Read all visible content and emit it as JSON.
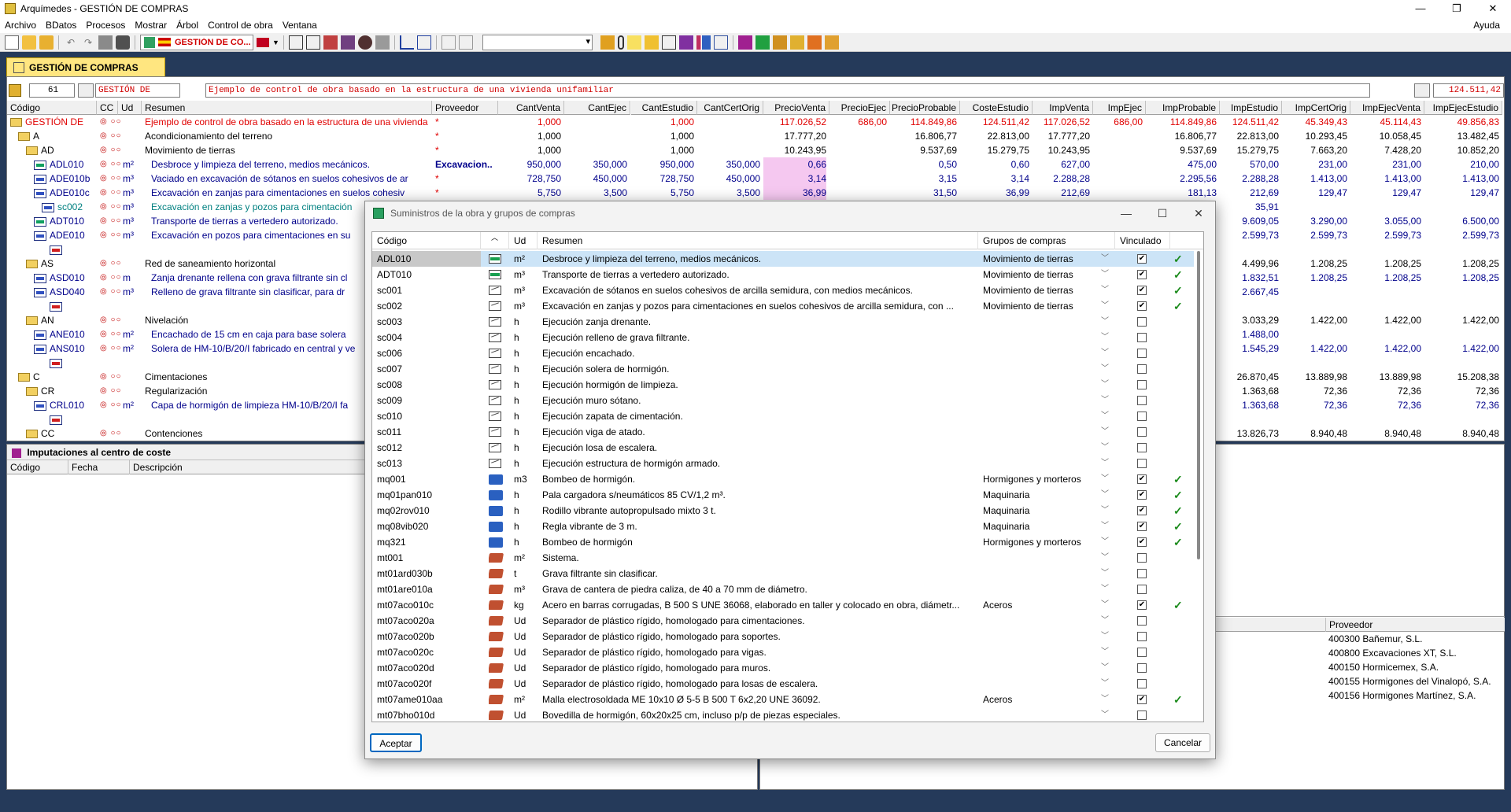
{
  "window": {
    "title": "Arquímedes - GESTIÓN DE COMPRAS",
    "help_menu": "Ayuda"
  },
  "menu": [
    "Archivo",
    "BDatos",
    "Procesos",
    "Mostrar",
    "Árbol",
    "Control de obra",
    "Ventana"
  ],
  "toolbar": {
    "group_combo": "GESTIÓN DE CO..."
  },
  "main_tab": "GESTIÓN DE COMPRAS",
  "header": {
    "count": "61",
    "code": "GESTIÓN DE",
    "summary": "Ejemplo de control de obra basado en la estructura de una vivienda unifamiliar",
    "total": "124.511,42"
  },
  "grid": {
    "columns": [
      "Código",
      "CC",
      "Ud",
      "Resumen",
      "Proveedor",
      "CantVenta",
      "CantEjec",
      "CantEstudio",
      "CantCertOrig",
      "PrecioVenta",
      "PrecioEjec",
      "PrecioProbable",
      "CosteEstudio",
      "ImpVenta",
      "ImpEjec",
      "ImpProbable",
      "ImpEstudio",
      "ImpCertOrig",
      "ImpEjecVenta",
      "ImpEjecEstudio"
    ],
    "rows": [
      {
        "code": "GESTIÓN DE",
        "ud": "",
        "resumen": "Ejemplo de control de obra basado en la estructura de una vivienda",
        "prov": "*",
        "v": [
          "1,000",
          "",
          "1,000",
          "",
          "117.026,52",
          "686,00",
          "114.849,86",
          "124.511,42",
          "117.026,52",
          "686,00",
          "114.849,86",
          "124.511,42",
          "45.349,43",
          "45.114,43",
          "49.856,83"
        ]
      },
      {
        "code": "A",
        "ud": "",
        "resumen": "Acondicionamiento del terreno",
        "prov": "*",
        "v": [
          "1,000",
          "",
          "1,000",
          "",
          "17.777,20",
          "",
          "16.806,77",
          "22.813,00",
          "17.777,20",
          "",
          "16.806,77",
          "22.813,00",
          "10.293,45",
          "10.058,45",
          "13.482,45"
        ]
      },
      {
        "code": "AD",
        "ud": "",
        "resumen": "Movimiento de tierras",
        "prov": "*",
        "v": [
          "1,000",
          "",
          "1,000",
          "",
          "10.243,95",
          "",
          "9.537,69",
          "15.279,75",
          "10.243,95",
          "",
          "9.537,69",
          "15.279,75",
          "7.663,20",
          "7.428,20",
          "10.852,20"
        ]
      },
      {
        "code": "ADL010",
        "ud": "m²",
        "resumen": "Desbroce y limpieza del terreno, medios mecánicos.",
        "prov": "Excavacion..",
        "v": [
          "950,000",
          "350,000",
          "950,000",
          "350,000",
          "0,66",
          "",
          "0,50",
          "0,60",
          "627,00",
          "",
          "475,00",
          "570,00",
          "231,00",
          "231,00",
          "210,00"
        ]
      },
      {
        "code": "ADE010b",
        "ud": "m³",
        "resumen": "Vaciado en excavación de sótanos en suelos cohesivos de ar",
        "prov": "*",
        "v": [
          "728,750",
          "450,000",
          "728,750",
          "450,000",
          "3,14",
          "",
          "3,15",
          "3,14",
          "2.288,28",
          "",
          "2.295,56",
          "2.288,28",
          "1.413,00",
          "1.413,00",
          "1.413,00"
        ]
      },
      {
        "code": "ADE010c",
        "ud": "m³",
        "resumen": "Excavación en zanjas para cimentaciones en suelos cohesiv",
        "prov": "*",
        "v": [
          "5,750",
          "3,500",
          "5,750",
          "3,500",
          "36,99",
          "",
          "31,50",
          "36,99",
          "212,69",
          "",
          "181,13",
          "212,69",
          "129,47",
          "129,47",
          "129,47"
        ]
      },
      {
        "code": "sc002",
        "ud": "m³",
        "resumen": "Excavación en zanjas y pozos para cimentación",
        "prov": "",
        "v": [
          "",
          "",
          "",
          "",
          "",
          "",
          "",
          "",
          "",
          "",
          "",
          "35,91",
          "",
          "",
          ""
        ]
      },
      {
        "code": "ADT010",
        "ud": "m³",
        "resumen": "Transporte de tierras a vertedero autorizado.",
        "prov": "",
        "v": [
          "",
          "",
          "",
          "",
          "",
          "",
          "",
          "",
          "",
          "",
          "",
          "9.609,05",
          "3.290,00",
          "3.055,00",
          "6.500,00"
        ]
      },
      {
        "code": "ADE010",
        "ud": "m³",
        "resumen": "Excavación en pozos para cimentaciones en su",
        "prov": "",
        "v": [
          "",
          "",
          "",
          "",
          "",
          "",
          "",
          "",
          "",
          "",
          "",
          "2.599,73",
          "2.599,73",
          "2.599,73",
          "2.599,73"
        ]
      },
      {
        "code": "",
        "ud": "",
        "resumen": "",
        "prov": "",
        "v": [
          "",
          "",
          "",
          "",
          "",
          "",
          "",
          "",
          "",
          "",
          "",
          "",
          "",
          "",
          ""
        ]
      },
      {
        "code": "AS",
        "ud": "",
        "resumen": "Red de saneamiento horizontal",
        "prov": "",
        "v": [
          "",
          "",
          "",
          "",
          "",
          "",
          "",
          "",
          "",
          "",
          "",
          "4.499,96",
          "1.208,25",
          "1.208,25",
          "1.208,25"
        ]
      },
      {
        "code": "ASD010",
        "ud": "m",
        "resumen": "Zanja drenante rellena con grava filtrante sin cl",
        "prov": "",
        "v": [
          "",
          "",
          "",
          "",
          "",
          "",
          "",
          "",
          "",
          "",
          "",
          "1.832,51",
          "1.208,25",
          "1.208,25",
          "1.208,25"
        ]
      },
      {
        "code": "ASD040",
        "ud": "m³",
        "resumen": "Relleno de grava filtrante sin clasificar, para dr",
        "prov": "",
        "v": [
          "",
          "",
          "",
          "",
          "",
          "",
          "",
          "",
          "",
          "",
          "",
          "2.667,45",
          "",
          "",
          ""
        ]
      },
      {
        "code": "",
        "ud": "",
        "resumen": "",
        "prov": "",
        "v": [
          "",
          "",
          "",
          "",
          "",
          "",
          "",
          "",
          "",
          "",
          "",
          "",
          "",
          "",
          ""
        ]
      },
      {
        "code": "AN",
        "ud": "",
        "resumen": "Nivelación",
        "prov": "",
        "v": [
          "",
          "",
          "",
          "",
          "",
          "",
          "",
          "",
          "",
          "",
          "",
          "3.033,29",
          "1.422,00",
          "1.422,00",
          "1.422,00"
        ]
      },
      {
        "code": "ANE010",
        "ud": "m²",
        "resumen": "Encachado de 15 cm en caja para base solera",
        "prov": "",
        "v": [
          "",
          "",
          "",
          "",
          "",
          "",
          "",
          "",
          "",
          "",
          "",
          "1.488,00",
          "",
          "",
          ""
        ]
      },
      {
        "code": "ANS010",
        "ud": "m²",
        "resumen": "Solera de HM-10/B/20/I fabricado en central y ve",
        "prov": "",
        "v": [
          "",
          "",
          "",
          "",
          "",
          "",
          "",
          "",
          "",
          "",
          "",
          "1.545,29",
          "1.422,00",
          "1.422,00",
          "1.422,00"
        ]
      },
      {
        "code": "",
        "ud": "",
        "resumen": "",
        "prov": "",
        "v": [
          "",
          "",
          "",
          "",
          "",
          "",
          "",
          "",
          "",
          "",
          "",
          "",
          "",
          "",
          ""
        ]
      },
      {
        "code": "C",
        "ud": "",
        "resumen": "Cimentaciones",
        "prov": "",
        "v": [
          "",
          "",
          "",
          "",
          "",
          "",
          "",
          "",
          "",
          "",
          "",
          "26.870,45",
          "13.889,98",
          "13.889,98",
          "15.208,38"
        ]
      },
      {
        "code": "CR",
        "ud": "",
        "resumen": "Regularización",
        "prov": "",
        "v": [
          "",
          "",
          "",
          "",
          "",
          "",
          "",
          "",
          "",
          "",
          "",
          "1.363,68",
          "72,36",
          "72,36",
          "72,36"
        ]
      },
      {
        "code": "CRL010",
        "ud": "m²",
        "resumen": "Capa de hormigón de limpieza HM-10/B/20/I fa",
        "prov": "",
        "v": [
          "",
          "",
          "",
          "",
          "",
          "",
          "",
          "",
          "",
          "",
          "",
          "1.363,68",
          "72,36",
          "72,36",
          "72,36"
        ]
      },
      {
        "code": "",
        "ud": "",
        "resumen": "",
        "prov": "",
        "v": [
          "",
          "",
          "",
          "",
          "",
          "",
          "",
          "",
          "",
          "",
          "",
          "",
          "",
          "",
          ""
        ]
      },
      {
        "code": "CC",
        "ud": "",
        "resumen": "Contenciones",
        "prov": "",
        "v": [
          "",
          "",
          "",
          "",
          "",
          "",
          "",
          "",
          "",
          "",
          "",
          "13.826,73",
          "8.940,48",
          "8.940,48",
          "8.940,48"
        ]
      }
    ]
  },
  "imputaciones": {
    "title": "Imputaciones al centro de coste",
    "columns": [
      "Código",
      "Fecha",
      "Descripción"
    ]
  },
  "proveedores": {
    "column": "Proveedor",
    "items": [
      "400300 Bañemur, S.L.",
      "400800 Excavaciones XT, S.L.",
      "400150 Hormicemex, S.A.",
      "400155 Hormigones del Vinalopó, S.A.",
      "400156 Hormigones Martínez, S.A."
    ]
  },
  "dialog": {
    "title": "Suministros de la obra y grupos de compras",
    "columns": [
      "Código",
      "Ud",
      "Resumen",
      "Grupos de compras",
      "Vinculado"
    ],
    "accept": "Aceptar",
    "cancel": "Cancelar",
    "rows": [
      {
        "code": "ADL010",
        "icon": "green",
        "ud": "m²",
        "resumen": "Desbroce y limpieza del terreno, medios mecánicos.",
        "grupo": "Movimiento de tierras",
        "linked": true
      },
      {
        "code": "ADT010",
        "icon": "green",
        "ud": "m³",
        "resumen": "Transporte de tierras a vertedero autorizado.",
        "grupo": "Movimiento de tierras",
        "linked": true
      },
      {
        "code": "sc001",
        "icon": "plain",
        "ud": "m³",
        "resumen": "Excavación de sótanos en suelos cohesivos de arcilla semidura, con medios mecánicos.",
        "grupo": "Movimiento de tierras",
        "linked": true
      },
      {
        "code": "sc002",
        "icon": "plain",
        "ud": "m³",
        "resumen": "Excavación en zanjas y pozos para cimentaciones en suelos cohesivos de arcilla semidura, con ...",
        "grupo": "Movimiento de tierras",
        "linked": true
      },
      {
        "code": "sc003",
        "icon": "plain",
        "ud": "h",
        "resumen": "Ejecución zanja drenante.",
        "grupo": "",
        "linked": false
      },
      {
        "code": "sc004",
        "icon": "plain",
        "ud": "h",
        "resumen": "Ejecución relleno de grava filtrante.",
        "grupo": "",
        "linked": false
      },
      {
        "code": "sc006",
        "icon": "plain",
        "ud": "h",
        "resumen": "Ejecución encachado.",
        "grupo": "",
        "linked": false
      },
      {
        "code": "sc007",
        "icon": "plain",
        "ud": "h",
        "resumen": "Ejecución solera de hormigón.",
        "grupo": "",
        "linked": false
      },
      {
        "code": "sc008",
        "icon": "plain",
        "ud": "h",
        "resumen": "Ejecución hormigón de limpieza.",
        "grupo": "",
        "linked": false
      },
      {
        "code": "sc009",
        "icon": "plain",
        "ud": "h",
        "resumen": "Ejecución muro sótano.",
        "grupo": "",
        "linked": false
      },
      {
        "code": "sc010",
        "icon": "plain",
        "ud": "h",
        "resumen": "Ejecución zapata de cimentación.",
        "grupo": "",
        "linked": false
      },
      {
        "code": "sc011",
        "icon": "plain",
        "ud": "h",
        "resumen": "Ejecución viga de atado.",
        "grupo": "",
        "linked": false
      },
      {
        "code": "sc012",
        "icon": "plain",
        "ud": "h",
        "resumen": "Ejecución losa de escalera.",
        "grupo": "",
        "linked": false
      },
      {
        "code": "sc013",
        "icon": "plain",
        "ud": "h",
        "resumen": "Ejecución estructura de hormigón armado.",
        "grupo": "",
        "linked": false
      },
      {
        "code": "mq001",
        "icon": "truck",
        "ud": "m3",
        "resumen": "Bombeo de hormigón.",
        "grupo": "Hormigones y morteros",
        "linked": true
      },
      {
        "code": "mq01pan010",
        "icon": "truck",
        "ud": "h",
        "resumen": "Pala cargadora s/neumáticos 85 CV/1,2 m³.",
        "grupo": "Maquinaria",
        "linked": true
      },
      {
        "code": "mq02rov010",
        "icon": "truck",
        "ud": "h",
        "resumen": "Rodillo vibrante autopropulsado mixto 3 t.",
        "grupo": "Maquinaria",
        "linked": true
      },
      {
        "code": "mq08vib020",
        "icon": "truck",
        "ud": "h",
        "resumen": "Regla vibrante de 3 m.",
        "grupo": "Maquinaria",
        "linked": true
      },
      {
        "code": "mq321",
        "icon": "truck",
        "ud": "h",
        "resumen": "Bombeo de hormigón",
        "grupo": "Hormigones y morteros",
        "linked": true
      },
      {
        "code": "mt001",
        "icon": "brick",
        "ud": "m²",
        "resumen": "Sistema.",
        "grupo": "",
        "linked": false
      },
      {
        "code": "mt01ard030b",
        "icon": "brick",
        "ud": "t",
        "resumen": "Grava filtrante sin clasificar.",
        "grupo": "",
        "linked": false
      },
      {
        "code": "mt01are010a",
        "icon": "brick",
        "ud": "m³",
        "resumen": "Grava de cantera de piedra caliza, de 40 a 70 mm de diámetro.",
        "grupo": "",
        "linked": false
      },
      {
        "code": "mt07aco010c",
        "icon": "brick",
        "ud": "kg",
        "resumen": "Acero en barras corrugadas, B 500 S UNE 36068, elaborado en taller y colocado en obra, diámetr...",
        "grupo": "Aceros",
        "linked": true
      },
      {
        "code": "mt07aco020a",
        "icon": "brick",
        "ud": "Ud",
        "resumen": "Separador de plástico rígido, homologado para cimentaciones.",
        "grupo": "",
        "linked": false
      },
      {
        "code": "mt07aco020b",
        "icon": "brick",
        "ud": "Ud",
        "resumen": "Separador de plástico rígido, homologado para soportes.",
        "grupo": "",
        "linked": false
      },
      {
        "code": "mt07aco020c",
        "icon": "brick",
        "ud": "Ud",
        "resumen": "Separador de plástico rígido, homologado para vigas.",
        "grupo": "",
        "linked": false
      },
      {
        "code": "mt07aco020d",
        "icon": "brick",
        "ud": "Ud",
        "resumen": "Separador de plástico rígido, homologado para muros.",
        "grupo": "",
        "linked": false
      },
      {
        "code": "mt07aco020f",
        "icon": "brick",
        "ud": "Ud",
        "resumen": "Separador de plástico rígido, homologado para losas de escalera.",
        "grupo": "",
        "linked": false
      },
      {
        "code": "mt07ame010aa",
        "icon": "brick",
        "ud": "m²",
        "resumen": "Malla electrosoldada ME 10x10 Ø 5-5 B 500 T 6x2,20 UNE 36092.",
        "grupo": "Aceros",
        "linked": true
      },
      {
        "code": "mt07bho010d",
        "icon": "brick",
        "ud": "Ud",
        "resumen": "Bovedilla de hormigón, 60x20x25 cm, incluso p/p de piezas especiales.",
        "grupo": "",
        "linked": false
      }
    ]
  }
}
